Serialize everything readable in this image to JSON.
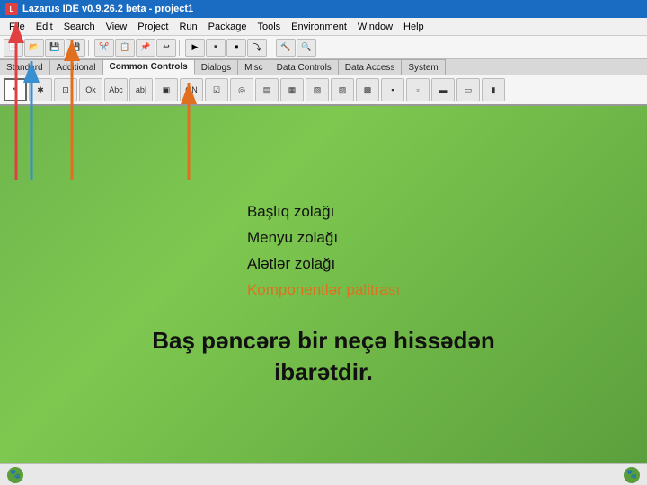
{
  "titleBar": {
    "title": "Lazarus IDE v0.9.26.2 beta - project1",
    "icon": "L"
  },
  "menuBar": {
    "items": [
      {
        "label": "File"
      },
      {
        "label": "Edit"
      },
      {
        "label": "Search"
      },
      {
        "label": "View"
      },
      {
        "label": "Project"
      },
      {
        "label": "Run"
      },
      {
        "label": "Package"
      },
      {
        "label": "Tools"
      },
      {
        "label": "Environment"
      },
      {
        "label": "Window"
      },
      {
        "label": "Help"
      }
    ]
  },
  "paletteTabs": [
    {
      "label": "Standard",
      "active": false
    },
    {
      "label": "Additional",
      "active": false
    },
    {
      "label": "Common Controls",
      "active": true
    },
    {
      "label": "Dialogs",
      "active": false
    },
    {
      "label": "Misc",
      "active": false
    },
    {
      "label": "Data Controls",
      "active": false
    },
    {
      "label": "Data Access",
      "active": false
    },
    {
      "label": "System",
      "active": false
    }
  ],
  "paletteComponents": [
    {
      "label": "▶",
      "title": "arrow"
    },
    {
      "label": "✱",
      "title": "comp1"
    },
    {
      "label": "⊡",
      "title": "comp2"
    },
    {
      "label": "Ok",
      "title": "comp3"
    },
    {
      "label": "Abc",
      "title": "comp4"
    },
    {
      "label": "ab|",
      "title": "comp5"
    },
    {
      "label": "▣",
      "title": "comp6"
    },
    {
      "label": "ON",
      "title": "comp7"
    },
    {
      "label": "☑",
      "title": "comp8"
    },
    {
      "label": "◎",
      "title": "comp9"
    },
    {
      "label": "▤",
      "title": "comp10"
    },
    {
      "label": "▦",
      "title": "comp11"
    },
    {
      "label": "▧",
      "title": "comp12"
    },
    {
      "label": "▨",
      "title": "comp13"
    },
    {
      "label": "▩",
      "title": "comp14"
    },
    {
      "label": "▪",
      "title": "comp15"
    },
    {
      "label": "▫",
      "title": "comp16"
    },
    {
      "label": "▬",
      "title": "comp17"
    },
    {
      "label": "▭",
      "title": "comp18"
    },
    {
      "label": "▮",
      "title": "comp19"
    }
  ],
  "labels": [
    {
      "text": "Başlıq zolağı",
      "color": "normal"
    },
    {
      "text": "Menyu zolağı",
      "color": "normal"
    },
    {
      "text": "Alətlər zolağı",
      "color": "normal"
    },
    {
      "text": "Komponentlər  palitrası",
      "color": "orange"
    }
  ],
  "bigText": {
    "line1": "Baş pəncərə bir neçə hissədən",
    "line2": "ibarətdir."
  },
  "statusBar": {
    "leftIcon": "🐾",
    "rightIcon": "🐾"
  },
  "arrows": {
    "colors": [
      "#e04040",
      "#e07020",
      "#3a8fd0",
      "#e07020"
    ]
  }
}
